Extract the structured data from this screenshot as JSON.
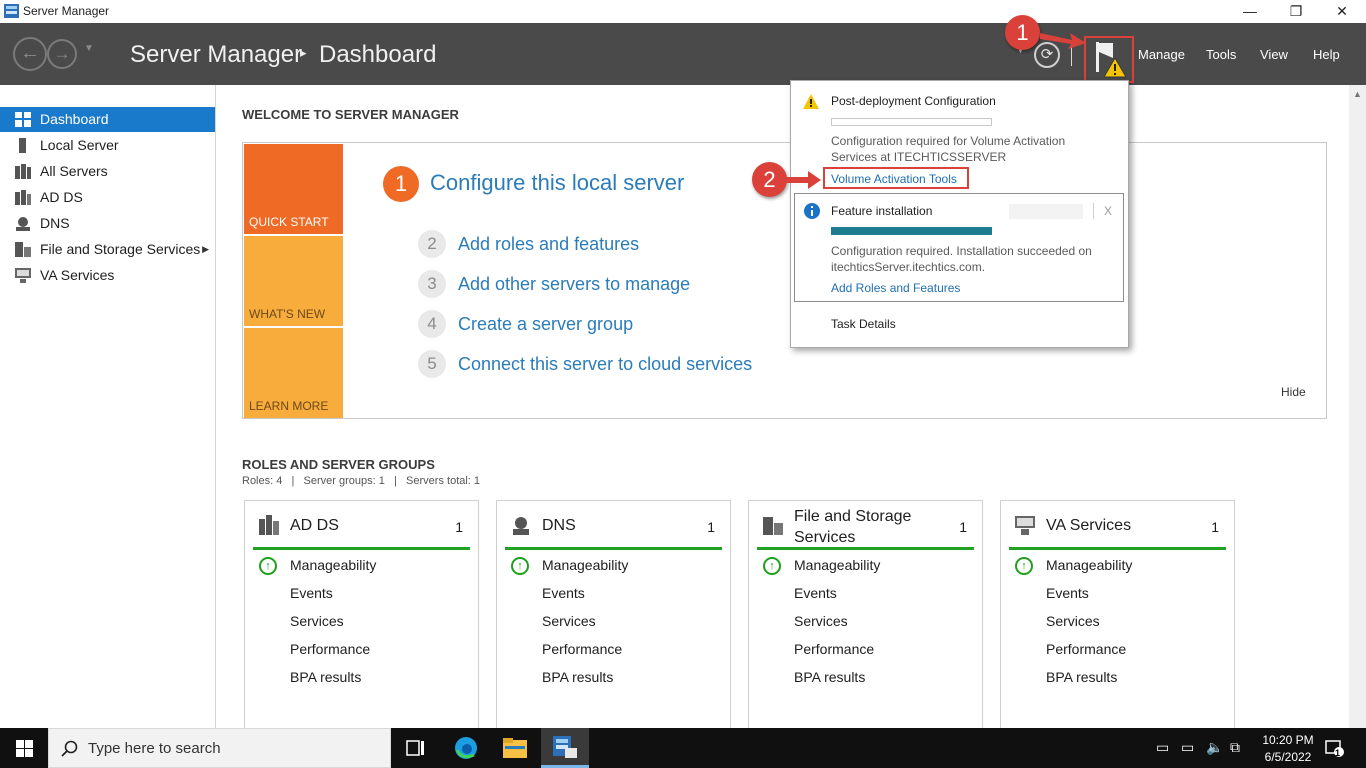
{
  "window": {
    "title": "Server Manager",
    "minimize": "—",
    "restore": "❐",
    "close": "✕"
  },
  "header": {
    "app_title": "Server Manager",
    "separator": "▸",
    "breadcrumb": "Dashboard",
    "menus": [
      "Manage",
      "Tools",
      "View",
      "Help"
    ]
  },
  "sidebar": {
    "items": [
      {
        "label": "Dashboard",
        "icon": "dashboard-icon",
        "active": true
      },
      {
        "label": "Local Server",
        "icon": "server-icon"
      },
      {
        "label": "All Servers",
        "icon": "servers-icon"
      },
      {
        "label": "AD DS",
        "icon": "ad-ds-icon"
      },
      {
        "label": "DNS",
        "icon": "dns-icon"
      },
      {
        "label": "File and Storage Services",
        "icon": "file-storage-icon",
        "has_submenu": true
      },
      {
        "label": "VA Services",
        "icon": "va-services-icon"
      }
    ]
  },
  "welcome": {
    "title": "WELCOME TO SERVER MANAGER",
    "quick_start": "QUICK START",
    "whats_new": "WHAT'S NEW",
    "learn_more": "LEARN MORE",
    "steps": [
      {
        "num": "1",
        "label": "Configure this local server"
      },
      {
        "num": "2",
        "label": "Add roles and features"
      },
      {
        "num": "3",
        "label": "Add other servers to manage"
      },
      {
        "num": "4",
        "label": "Create a server group"
      },
      {
        "num": "5",
        "label": "Connect this server to cloud services"
      }
    ],
    "hide": "Hide"
  },
  "roles": {
    "title": "ROLES AND SERVER GROUPS",
    "summary": "Roles: 4   |   Server groups: 1   |   Servers total: 1",
    "rows": [
      "Manageability",
      "Events",
      "Services",
      "Performance",
      "BPA results"
    ],
    "tiles": [
      {
        "name": "AD DS",
        "count": "1",
        "icon": "ad-ds-icon"
      },
      {
        "name": "DNS",
        "count": "1",
        "icon": "dns-icon"
      },
      {
        "name": "File and Storage Services",
        "count": "1",
        "icon": "file-storage-icon"
      },
      {
        "name": "VA Services",
        "count": "1",
        "icon": "va-services-icon"
      }
    ]
  },
  "notifications": {
    "post_deploy": {
      "title": "Post-deployment Configuration",
      "desc": "Configuration required for Volume Activation Services at ITECHTICSSERVER",
      "link": "Volume Activation Tools"
    },
    "feature": {
      "title": "Feature installation",
      "desc": "Configuration required. Installation succeeded on itechticsServer.itechtics.com.",
      "link": "Add Roles and Features",
      "close": "X",
      "progress": 1.0
    },
    "task_details": "Task Details"
  },
  "annotations": {
    "badge1": "1",
    "badge2": "2",
    "color": "#d9413a"
  },
  "taskbar": {
    "search_placeholder": "Type here to search",
    "time": "10:20 PM",
    "date": "6/5/2022",
    "notif_count": "1"
  },
  "colors": {
    "accent": "#1979ca",
    "header": "#4a4a4a",
    "quick_start": "#ee6a25",
    "whats_new": "#f8ac3c",
    "learn_more": "#f8ac3c",
    "link": "#2b7cba",
    "ok": "#22a122"
  }
}
